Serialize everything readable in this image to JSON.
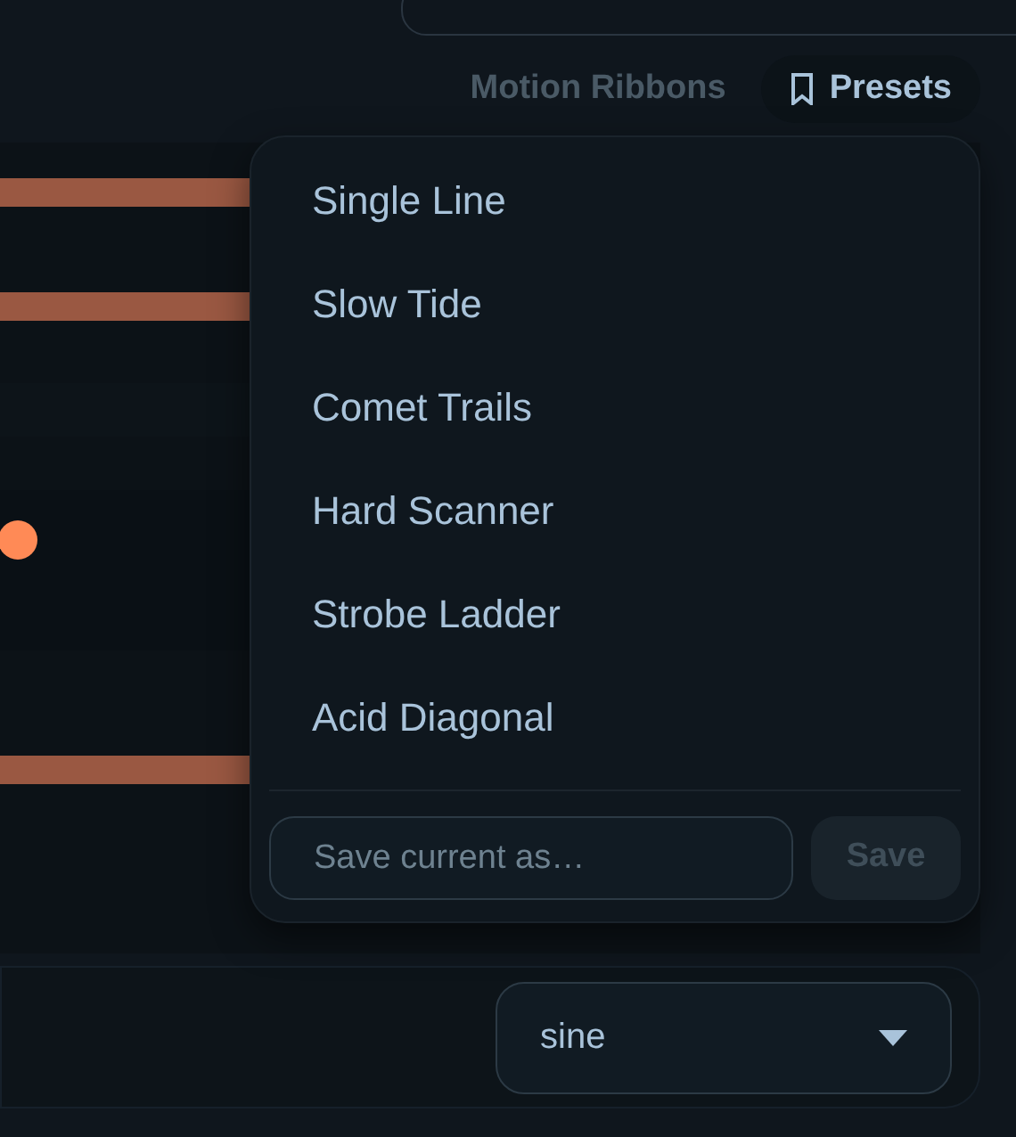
{
  "header": {
    "title": "Motion Ribbons",
    "presets_button": "Presets"
  },
  "presets_menu": {
    "items": [
      {
        "label": "Single Line"
      },
      {
        "label": "Slow Tide"
      },
      {
        "label": "Comet Trails"
      },
      {
        "label": "Hard Scanner"
      },
      {
        "label": "Strobe Ladder"
      },
      {
        "label": "Acid Diagonal"
      }
    ],
    "save_field": {
      "placeholder": "Save current as…"
    },
    "save_button": {
      "label": "Save",
      "disabled": true
    }
  },
  "waveform_select": {
    "value": "sine"
  }
}
